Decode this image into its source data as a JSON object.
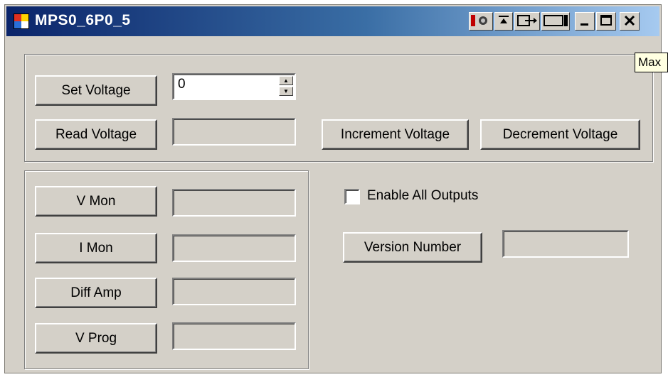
{
  "window": {
    "title": "MPS0_6P0_5",
    "controls": {
      "extra_buttons": [
        "record-icon",
        "pin-top-icon",
        "move-out-icon",
        "rectangle-icon"
      ],
      "minimize": "minimize-icon",
      "maximize": "maximize-icon",
      "close": "close-icon"
    }
  },
  "tooltip": {
    "text": "Max"
  },
  "voltage_group": {
    "set_voltage_label": "Set Voltage",
    "set_voltage_value": "0",
    "read_voltage_label": "Read Voltage",
    "read_voltage_value": "",
    "increment_label": "Increment Voltage",
    "decrement_label": "Decrement Voltage"
  },
  "monitor_group": {
    "items": [
      {
        "label": "V Mon",
        "value": ""
      },
      {
        "label": "I Mon",
        "value": ""
      },
      {
        "label": "Diff Amp",
        "value": ""
      },
      {
        "label": "V Prog",
        "value": ""
      }
    ]
  },
  "outputs": {
    "enable_all_label": "Enable All Outputs",
    "enable_all_checked": false,
    "version_label": "Version Number",
    "version_value": ""
  },
  "colors": {
    "face": "#d4d0c8",
    "title_start": "#0a246a",
    "title_end": "#a6caf0"
  }
}
